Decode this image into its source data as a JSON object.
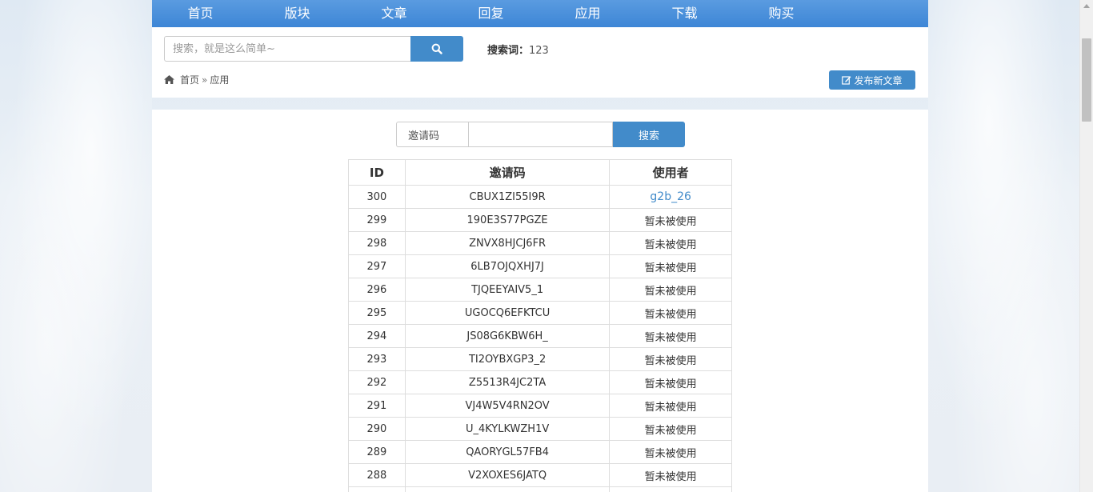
{
  "nav": {
    "items": [
      "首页",
      "版块",
      "文章",
      "回复",
      "应用",
      "下载",
      "购买"
    ]
  },
  "header": {
    "search_placeholder": "搜索，就是这么简单~",
    "keyword_label": "搜索词：",
    "keyword_value": "123",
    "breadcrumb": {
      "home": "首页",
      "sep": "»",
      "current": "应用"
    },
    "publish_label": "发布新文章"
  },
  "invite": {
    "label": "邀请码",
    "submit_label": "搜索"
  },
  "table": {
    "headers": [
      "ID",
      "邀请码",
      "使用者"
    ],
    "rows": [
      {
        "id": "300",
        "code": "CBUX1ZI55I9R",
        "user": "g2b_26",
        "link": true
      },
      {
        "id": "299",
        "code": "190E3S77PGZE",
        "user": "暂未被使用"
      },
      {
        "id": "298",
        "code": "ZNVX8HJCJ6FR",
        "user": "暂未被使用"
      },
      {
        "id": "297",
        "code": "6LB7OJQXHJ7J",
        "user": "暂未被使用"
      },
      {
        "id": "296",
        "code": "TJQEEYAIV5_1",
        "user": "暂未被使用"
      },
      {
        "id": "295",
        "code": "UGOCQ6EFKTCU",
        "user": "暂未被使用"
      },
      {
        "id": "294",
        "code": "JS08G6KBW6H_",
        "user": "暂未被使用"
      },
      {
        "id": "293",
        "code": "TI2OYBXGP3_2",
        "user": "暂未被使用"
      },
      {
        "id": "292",
        "code": "Z5513R4JC2TA",
        "user": "暂未被使用"
      },
      {
        "id": "291",
        "code": "VJ4W5V4RN2OV",
        "user": "暂未被使用"
      },
      {
        "id": "290",
        "code": "U_4KYLKWZH1V",
        "user": "暂未被使用"
      },
      {
        "id": "289",
        "code": "QAORYGL57FB4",
        "user": "暂未被使用"
      },
      {
        "id": "288",
        "code": "V2XOXES6JATQ",
        "user": "暂未被使用"
      },
      {
        "id": "",
        "code": "",
        "user": ""
      }
    ]
  },
  "colors": {
    "accent": "#428bca",
    "nav_top": "#5a9be0",
    "nav_bottom": "#3d86d6"
  },
  "icons": {
    "search": "search-icon",
    "home": "home-icon",
    "edit": "edit-icon"
  }
}
